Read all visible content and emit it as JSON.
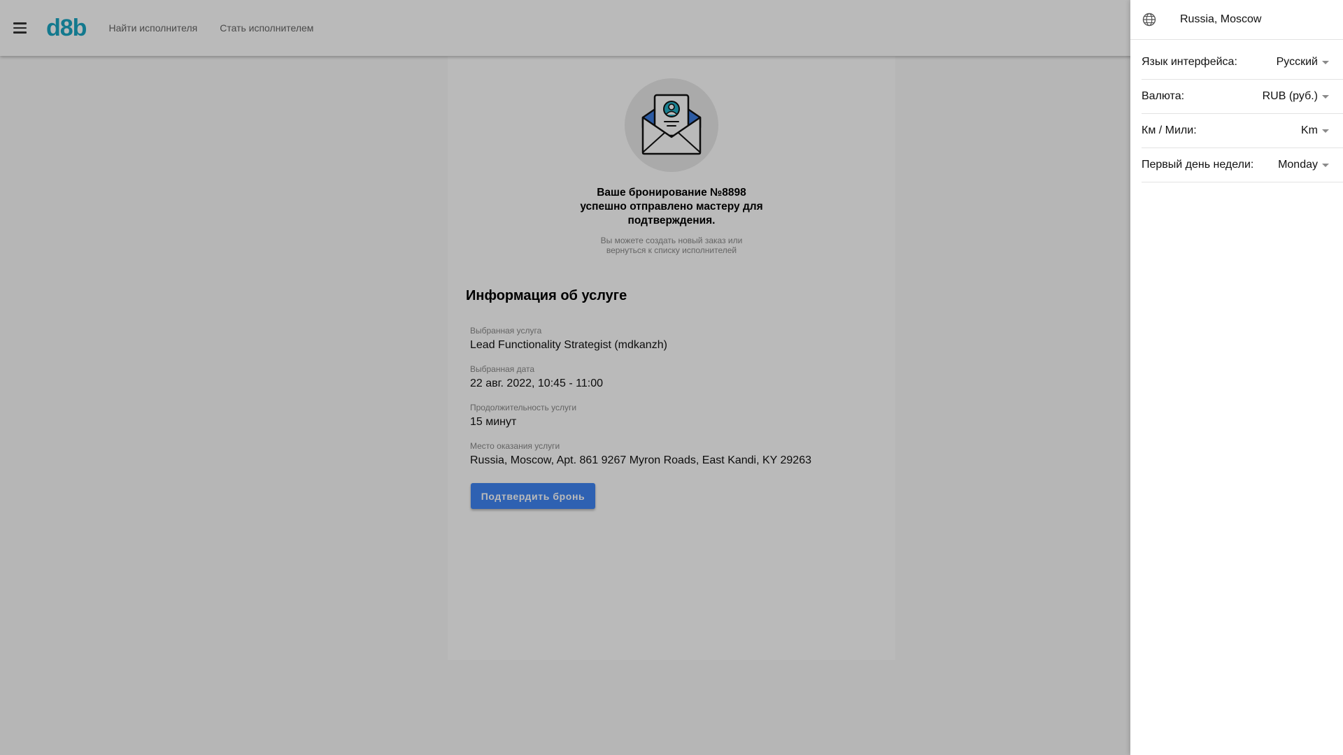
{
  "header": {
    "logo": "d8b",
    "nav": [
      {
        "label": "Найти исполнителя"
      },
      {
        "label": "Стать исполнителем"
      }
    ]
  },
  "booking": {
    "title": "Ваше бронирование №8898 успешно отправлено мастеру для подтверждения.",
    "subtitle": "Вы можете создать новый заказ или вернуться к списку исполнителей",
    "info_heading": "Информация об услуге",
    "fields": [
      {
        "label": "Выбранная услуга",
        "value": "Lead Functionality Strategist (mdkanzh)"
      },
      {
        "label": "Выбранная дата",
        "value": "22 авг. 2022, 10:45 - 11:00"
      },
      {
        "label": "Продолжительность услуги",
        "value": "15 минут"
      },
      {
        "label": "Место оказания услуги",
        "value": "Russia, Moscow, Apt. 861 9267 Myron Roads, East Kandi, KY 29263"
      }
    ],
    "confirm_label": "Подтвердить бронь"
  },
  "drawer": {
    "location": "Russia, Moscow",
    "settings": [
      {
        "label": "Язык интерфейса:",
        "value": "Русский"
      },
      {
        "label": "Валюта:",
        "value": "RUB (руб.)"
      },
      {
        "label": "Км / Мили:",
        "value": "Km"
      },
      {
        "label": "Первый день недели:",
        "value": "Monday"
      }
    ]
  },
  "colors": {
    "brand": "#1ba7c3",
    "button": "#3f86f4",
    "overlay": "rgba(0,0,0,0.27)"
  },
  "icons": [
    "menu-icon",
    "envelope-icon",
    "globe-icon",
    "caret-down-icon"
  ]
}
